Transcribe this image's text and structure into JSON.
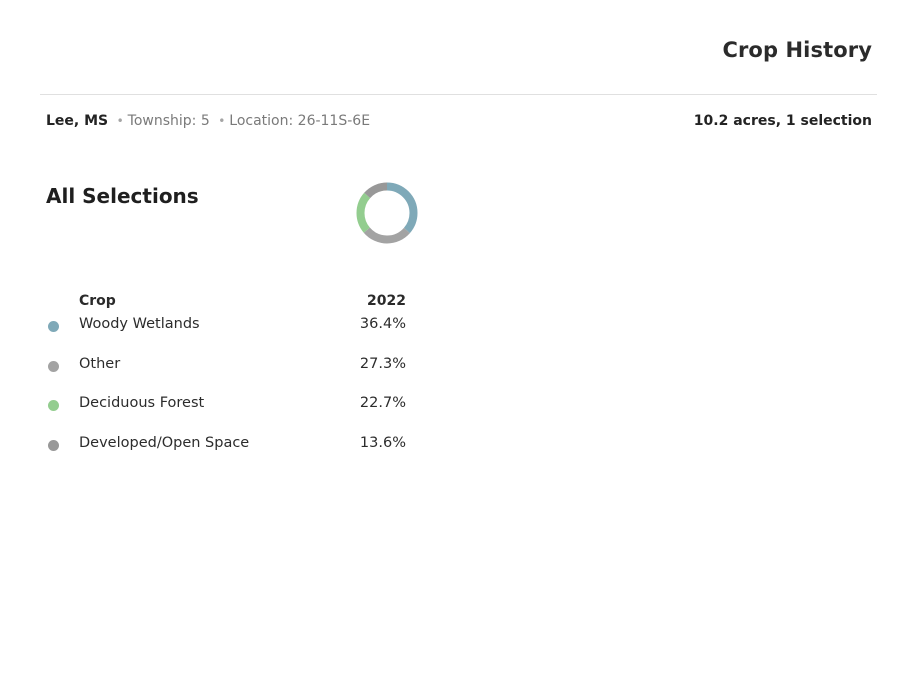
{
  "header": {
    "title": "Crop History"
  },
  "location": {
    "county": "Lee, MS",
    "separator": "•",
    "township": "Township: 5",
    "location": "Location: 26-11S-6E",
    "acreage": "10.2 acres, 1 selection"
  },
  "section": {
    "title": "All Selections"
  },
  "table": {
    "headers": {
      "crop": "Crop",
      "year": "2022"
    },
    "rows": [
      {
        "name": "Woody Wetlands",
        "percent": "36.4%",
        "color": "#7fa9b8",
        "value": 36.4
      },
      {
        "name": "Other",
        "percent": "27.3%",
        "color": "#a3a3a3",
        "value": 27.3
      },
      {
        "name": "Deciduous Forest",
        "percent": "22.7%",
        "color": "#93cd8f",
        "value": 22.7
      },
      {
        "name": "Developed/Open Space",
        "percent": "13.6%",
        "color": "#989898",
        "value": 13.6
      }
    ]
  }
}
